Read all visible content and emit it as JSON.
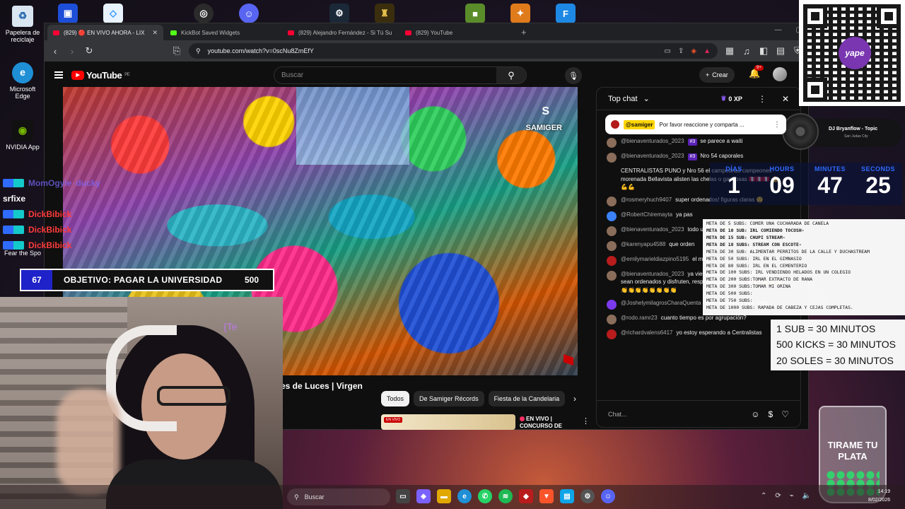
{
  "desktop": {
    "icons": [
      {
        "label": "Papelera de reciclaje",
        "icon": "recycle-bin-icon"
      },
      {
        "label": "Microsoft Edge",
        "icon": "edge-icon"
      },
      {
        "label": "NVIDIA App",
        "icon": "nvidia-icon"
      },
      {
        "label": "Fear the Spo",
        "icon": "game-icon"
      }
    ],
    "top_apps": [
      "app-icon",
      "app-icon",
      "obs-icon",
      "discord-icon",
      "steam-icon",
      "game-icon",
      "minecraft-icon",
      "counter-strike-icon",
      "app-icon"
    ]
  },
  "browser": {
    "tabs": [
      {
        "label": "(829) 🔴 EN VIVO AHORA - LIX",
        "favicon": "youtube",
        "active": true
      },
      {
        "label": "KickBot Saved Widgets",
        "favicon": "kick",
        "active": false
      },
      {
        "label": "(829) Alejandro Fernández - Si Tú Su",
        "favicon": "youtube",
        "active": false
      },
      {
        "label": "(829) YouTube",
        "favicon": "youtube",
        "active": false
      }
    ],
    "url": "youtube.com/watch?v=0scNu8ZmEfY"
  },
  "youtube": {
    "logo": "YouTube",
    "country": "PE",
    "search_placeholder": "Buscar",
    "create_label": "Crear",
    "notif_badge": "9+",
    "video_watermark": "SAMIGER",
    "video_title": "es de Luces | Virgen",
    "chips": [
      "Todos",
      "De Samiger Récords",
      "Fiesta de la Candelaria"
    ],
    "rec": {
      "badge": "EN VIVO",
      "line1": "EN VIVO |",
      "line2": "CONCURSO DE"
    }
  },
  "chat": {
    "mode": "Top chat",
    "xp": "0 XP",
    "pinned": {
      "author": "@samiger",
      "text": "Por favor reaccione y comparta ..."
    },
    "messages": [
      {
        "author": "@bienaventurados_2023",
        "badge": "#3",
        "text": "se parece a waiti"
      },
      {
        "author": "@bienaventurados_2023",
        "badge": "#3",
        "text": "Nro 54 caporales"
      },
      {
        "author": "",
        "badge": "",
        "text": "CENTRALISTAS PUNO y Nro 56 el campeonas campeones morenada Bellavista alisten las chelas o gaseosas 🇵🇪🇵🇪🇵🇪 💪💪💪"
      },
      {
        "author": "@rosmeryhuch9407",
        "badge": "",
        "text": "super ordenados! figuras claras 😲"
      },
      {
        "author": "@RobertChiremayta",
        "badge": "",
        "text": "ya pas"
      },
      {
        "author": "@bienaventurados_2023",
        "badge": "",
        "text": "todo un país, 😭😭😭"
      },
      {
        "author": "@karenyapu4588",
        "badge": "",
        "text": "que orden"
      },
      {
        "author": "@emilymarieldiazpino5195",
        "badge": "",
        "text": "el momento ordenados"
      },
      {
        "author": "@bienaventurados_2023",
        "badge": "",
        "text": "ya viene, buena vibra, bailen bien, sean ordenados y disfruten, respeten los tiempos 🇵🇪🇵🇪 💪💪💪👏👏👏👏👏👏👏👏"
      },
      {
        "author": "@JoshelymilagrosCharaQuenta",
        "badge": "",
        "text": "que ordenando muy lindo"
      },
      {
        "author": "@rodo.ramr23",
        "badge": "",
        "text": "cuanto tiempo es por agrupación?"
      },
      {
        "author": "@richardvalens6417",
        "badge": "",
        "text": "yo estoy esperando a Centralistas"
      }
    ],
    "input_placeholder": "Chat..."
  },
  "overlays": {
    "qr_brand": "yape",
    "dj": {
      "title": "DJ Bryanflow - Topic",
      "subtitle": "San Judas City"
    },
    "timer": {
      "labels": [
        "DÍAS",
        "HOURS",
        "MINUTES",
        "SECONDS"
      ],
      "values": [
        "1",
        "09",
        "47",
        "25"
      ]
    },
    "goals": [
      {
        "text": "META DE 5 SUBS: COMER UNA CUCHARADA DE CANELA",
        "bold": false
      },
      {
        "text": "META DE 10 SUB: IRL COMIENDO TOCOSH-",
        "bold": true
      },
      {
        "text": "META DE 15 SUB: CHUPI STREAM-",
        "bold": true
      },
      {
        "text": "META DE 18 SUBS: STREAM CON ESCOTE-",
        "bold": true
      },
      {
        "text": "META DE 30 SUB:  ALIMENTAR PERRITOS DE LA CALLE Y DUCHASTREAM",
        "bold": false
      },
      {
        "text": "META DE 50 SUBS: IRL EN EL GIMNASIO",
        "bold": false
      },
      {
        "text": "META DE 80 SUBS: IRL EN EL CEMENTERIO",
        "bold": false
      },
      {
        "text": "META DE 100 SUBS: IRL VENDIENDO HELADOS EN UN COLEGIO",
        "bold": false
      },
      {
        "text": "META DE 200 SUBS:TOMAR EXTRACTO DE RANA",
        "bold": false
      },
      {
        "text": "META DE 300 SUBS:TOMAR MI ORINA",
        "bold": false
      },
      {
        "text": "META DE 500 SUBS:",
        "bold": false
      },
      {
        "text": "META DE 750 SUBS:",
        "bold": false
      },
      {
        "text": "META DE 1000 SUBS: RAPADA DE CABEZA Y CEJAS COMPLETAS.",
        "bold": false
      }
    ],
    "sub_rates": [
      "1 SUB = 30 MINUTOS",
      "500 KICKS = 30 MINUTOS",
      "20 SOLES = 30 MINUTOS"
    ],
    "objective": {
      "current": "67",
      "label": "OBJETIVO: PAGAR LA UNIVERSIDAD",
      "target": "500",
      "progress": 0.134
    },
    "overlay_chat": [
      {
        "name": "MomOgyie",
        "text": "ducky",
        "faded": true
      },
      {
        "name": "srfixe",
        "text": "",
        "faded": false
      },
      {
        "name": "DickBibick",
        "text": "",
        "faded": false
      },
      {
        "name": "DickBibick",
        "text": "",
        "faded": false
      },
      {
        "name": "DickBibick",
        "text": "",
        "faded": false
      }
    ],
    "webcam_text": "{Te",
    "jar_text": "TIRAME TU PLATA"
  },
  "taskbar": {
    "search_placeholder": "Buscar",
    "time": "14:19",
    "date": "8/02/2026"
  }
}
